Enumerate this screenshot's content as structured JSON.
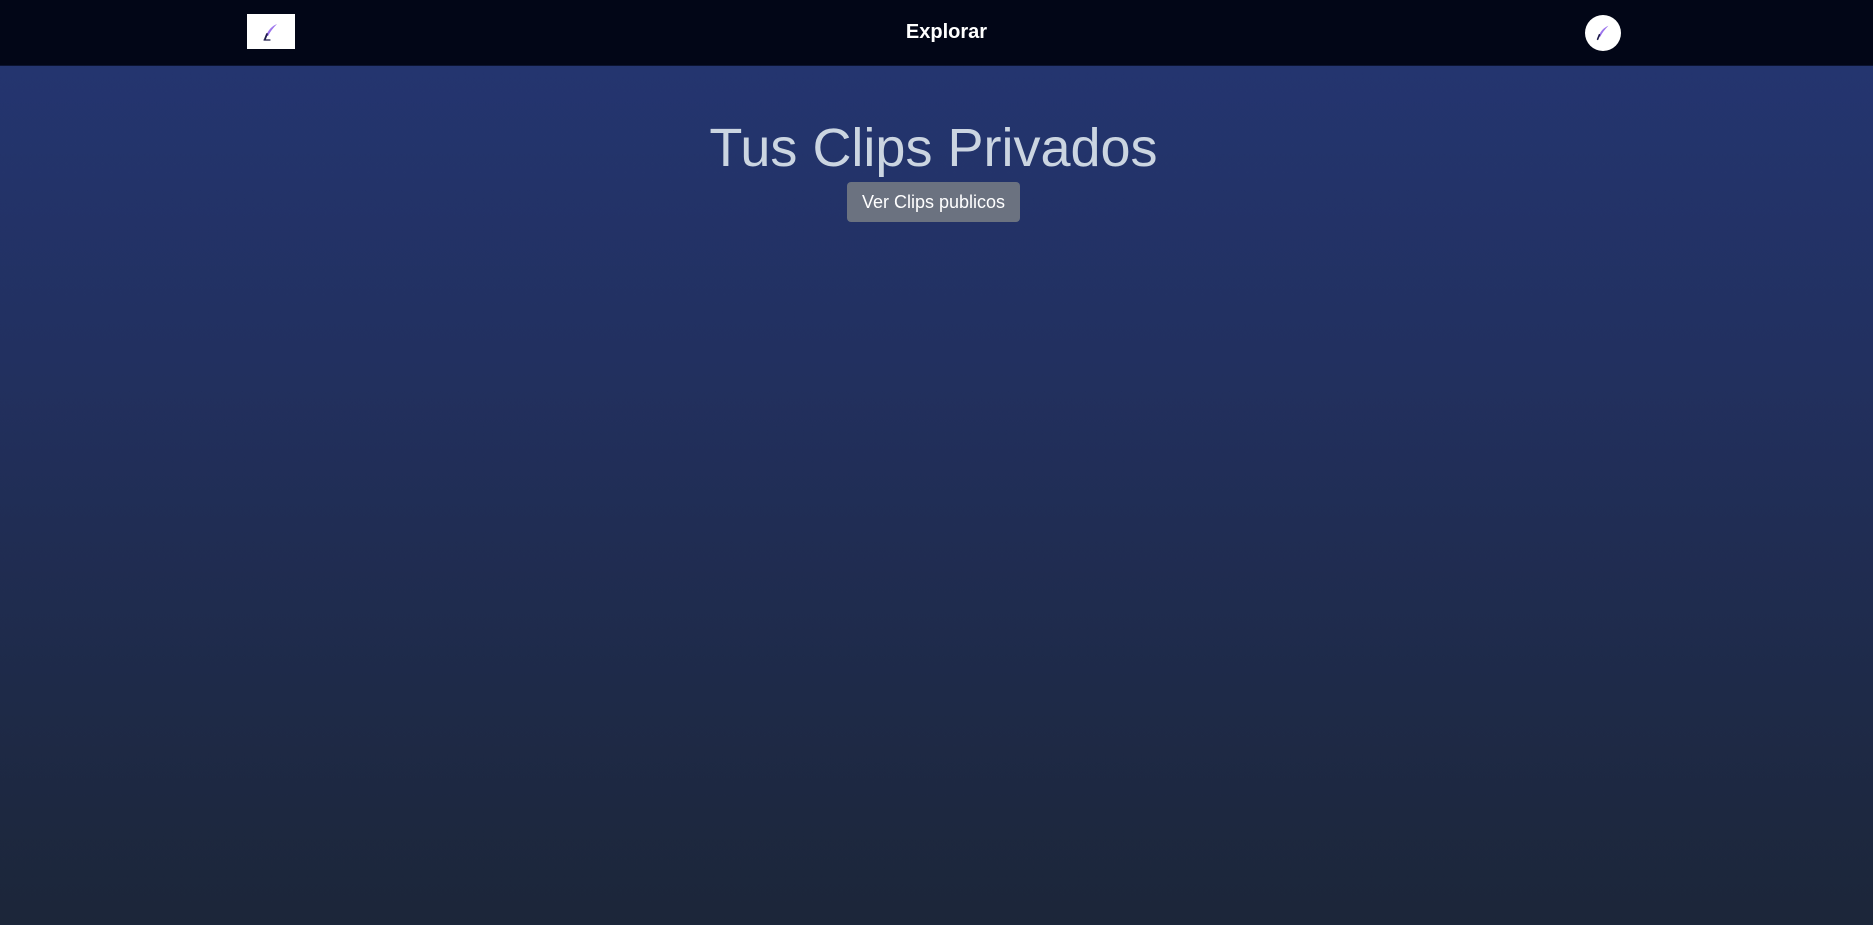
{
  "header": {
    "logo_icon": "quill-pen-icon",
    "nav_label": "Explorar",
    "avatar_icon": "quill-pen-icon"
  },
  "main": {
    "title": "Tus Clips Privados",
    "public_button_label": "Ver Clips publicos"
  },
  "colors": {
    "topbar": "#020617",
    "button": "#6b7280",
    "title": "#cbd5e1",
    "background_top": "#243673",
    "background_bottom": "#1c2639"
  }
}
